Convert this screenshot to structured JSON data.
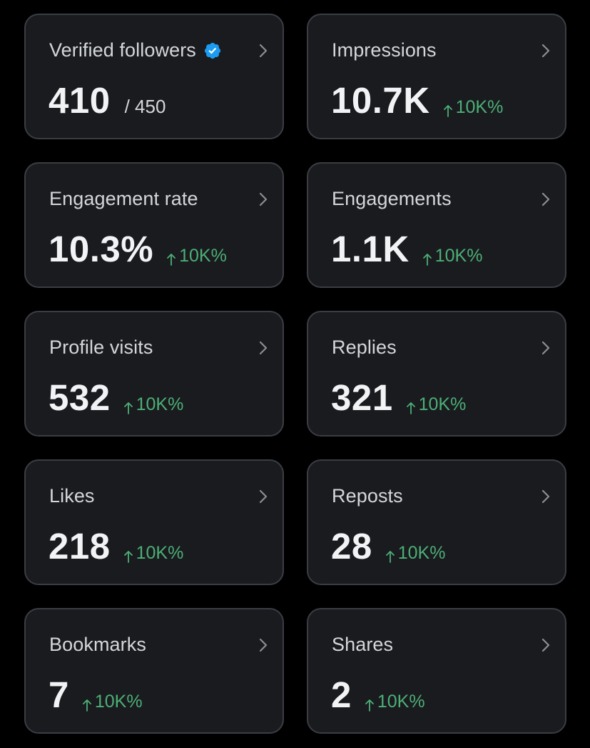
{
  "colors": {
    "background": "#000000",
    "card": "#1a1b1f",
    "card_border": "#3a3d44",
    "positive": "#4caf76",
    "verified": "#1d9bf0"
  },
  "cards": [
    {
      "label": "Verified followers",
      "icon": "verified-badge-icon",
      "value": "410",
      "total": "/ 450"
    },
    {
      "label": "Impressions",
      "value": "10.7K",
      "change": "10K%",
      "change_icon": "arrow-up-icon"
    },
    {
      "label": "Engagement rate",
      "value": "10.3%",
      "change": "10K%",
      "change_icon": "arrow-up-icon"
    },
    {
      "label": "Engagements",
      "value": "1.1K",
      "change": "10K%",
      "change_icon": "arrow-up-icon"
    },
    {
      "label": "Profile visits",
      "value": "532",
      "change": "10K%",
      "change_icon": "arrow-up-icon"
    },
    {
      "label": "Replies",
      "value": "321",
      "change": "10K%",
      "change_icon": "arrow-up-icon"
    },
    {
      "label": "Likes",
      "value": "218",
      "change": "10K%",
      "change_icon": "arrow-up-icon"
    },
    {
      "label": "Reposts",
      "value": "28",
      "change": "10K%",
      "change_icon": "arrow-up-icon"
    },
    {
      "label": "Bookmarks",
      "value": "7",
      "change": "10K%",
      "change_icon": "arrow-up-icon"
    },
    {
      "label": "Shares",
      "value": "2",
      "change": "10K%",
      "change_icon": "arrow-up-icon"
    }
  ]
}
